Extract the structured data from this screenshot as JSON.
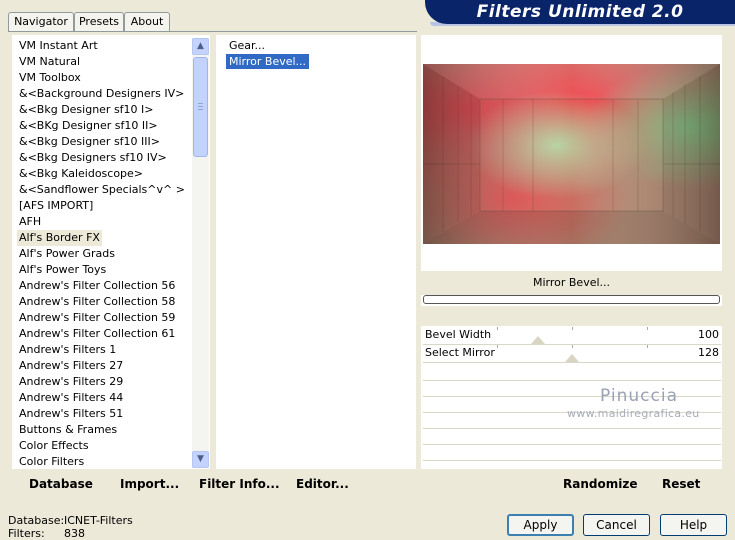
{
  "banner": {
    "title": "Filters Unlimited 2.0"
  },
  "tabs": [
    {
      "label": "Navigator",
      "active": true
    },
    {
      "label": "Presets",
      "active": false
    },
    {
      "label": "About",
      "active": false
    }
  ],
  "categories": [
    "VM Instant Art",
    "VM Natural",
    "VM Toolbox",
    "&<Background Designers IV>",
    "&<Bkg Designer sf10 I>",
    "&<BKg Designer sf10 II>",
    "&<Bkg Designer sf10 III>",
    "&<Bkg Designers sf10 IV>",
    "&<Bkg Kaleidoscope>",
    "&<Sandflower Specials^v^ >",
    "[AFS IMPORT]",
    "AFH",
    "Alf's Border FX",
    "Alf's Power Grads",
    "Alf's Power Toys",
    "Andrew's Filter Collection 56",
    "Andrew's Filter Collection 58",
    "Andrew's Filter Collection 59",
    "Andrew's Filter Collection 61",
    "Andrew's Filters 1",
    "Andrew's Filters 27",
    "Andrew's Filters 29",
    "Andrew's Filters 44",
    "Andrew's Filters 51",
    "Buttons & Frames",
    "Color Effects",
    "Color Filters"
  ],
  "selected_category": "Alf's Border FX",
  "filters": [
    {
      "label": "Gear...",
      "selected": false
    },
    {
      "label": "Mirror Bevel...",
      "selected": true
    }
  ],
  "toolbar": {
    "database": "Database",
    "import": "Import...",
    "filter_info": "Filter Info...",
    "editor": "Editor...",
    "randomize": "Randomize",
    "reset": "Reset"
  },
  "filter_name": "Mirror Bevel...",
  "params": [
    {
      "label": "Bevel Width",
      "value": 100,
      "fraction": 0.39
    },
    {
      "label": "Select Mirror",
      "value": 128,
      "fraction": 0.5
    }
  ],
  "watermark": {
    "line1": "Pinuccia",
    "line2": "www.maidiregrafica.eu"
  },
  "status": {
    "db_label": "Database:",
    "db_value": "ICNET-Filters",
    "filters_label": "Filters:",
    "filters_value": "838"
  },
  "buttons": {
    "apply": "Apply",
    "cancel": "Cancel",
    "help": "Help"
  },
  "colors": {
    "banner": "#0a246a",
    "selection": "#316ac5",
    "chrome": "#ece9d8"
  }
}
